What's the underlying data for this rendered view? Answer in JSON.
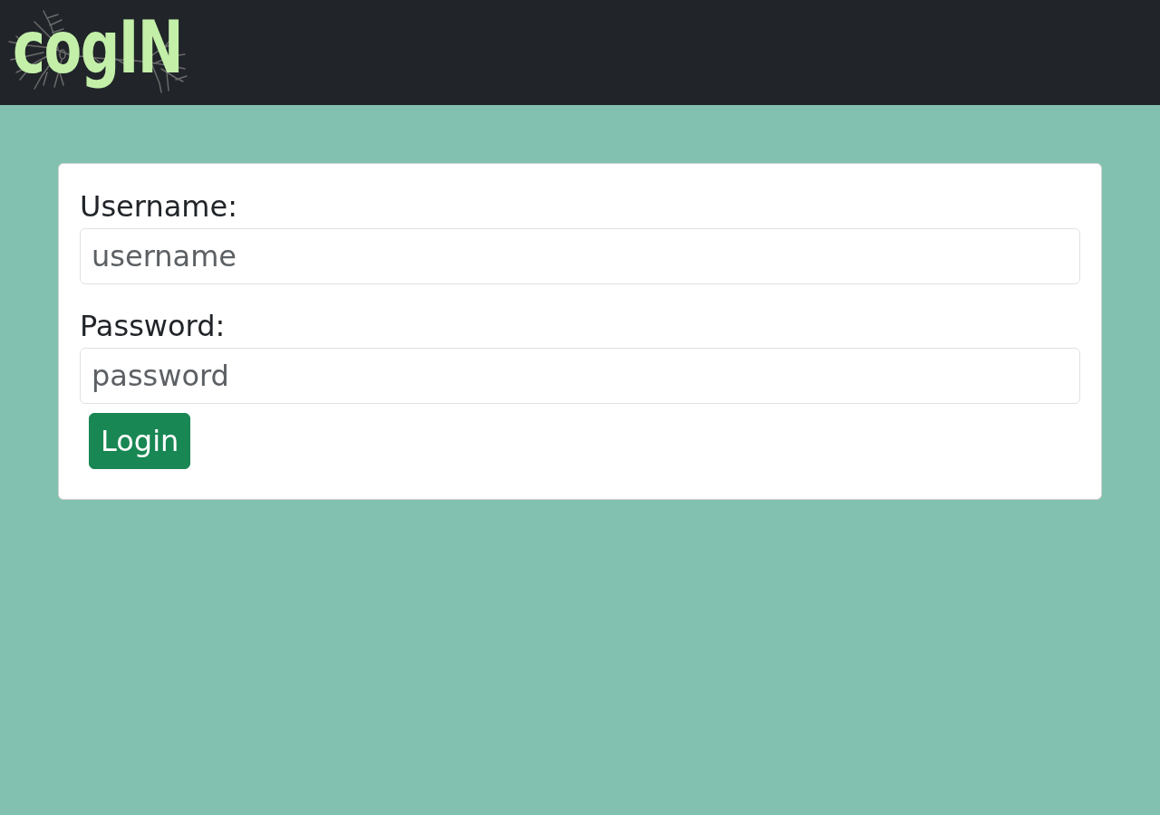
{
  "navbar": {
    "logo_text": "cogIN"
  },
  "login_form": {
    "fields": [
      {
        "label": "Username:",
        "placeholder": "username"
      },
      {
        "label": "Password:",
        "placeholder": "password"
      }
    ],
    "submit_button": "Login"
  }
}
